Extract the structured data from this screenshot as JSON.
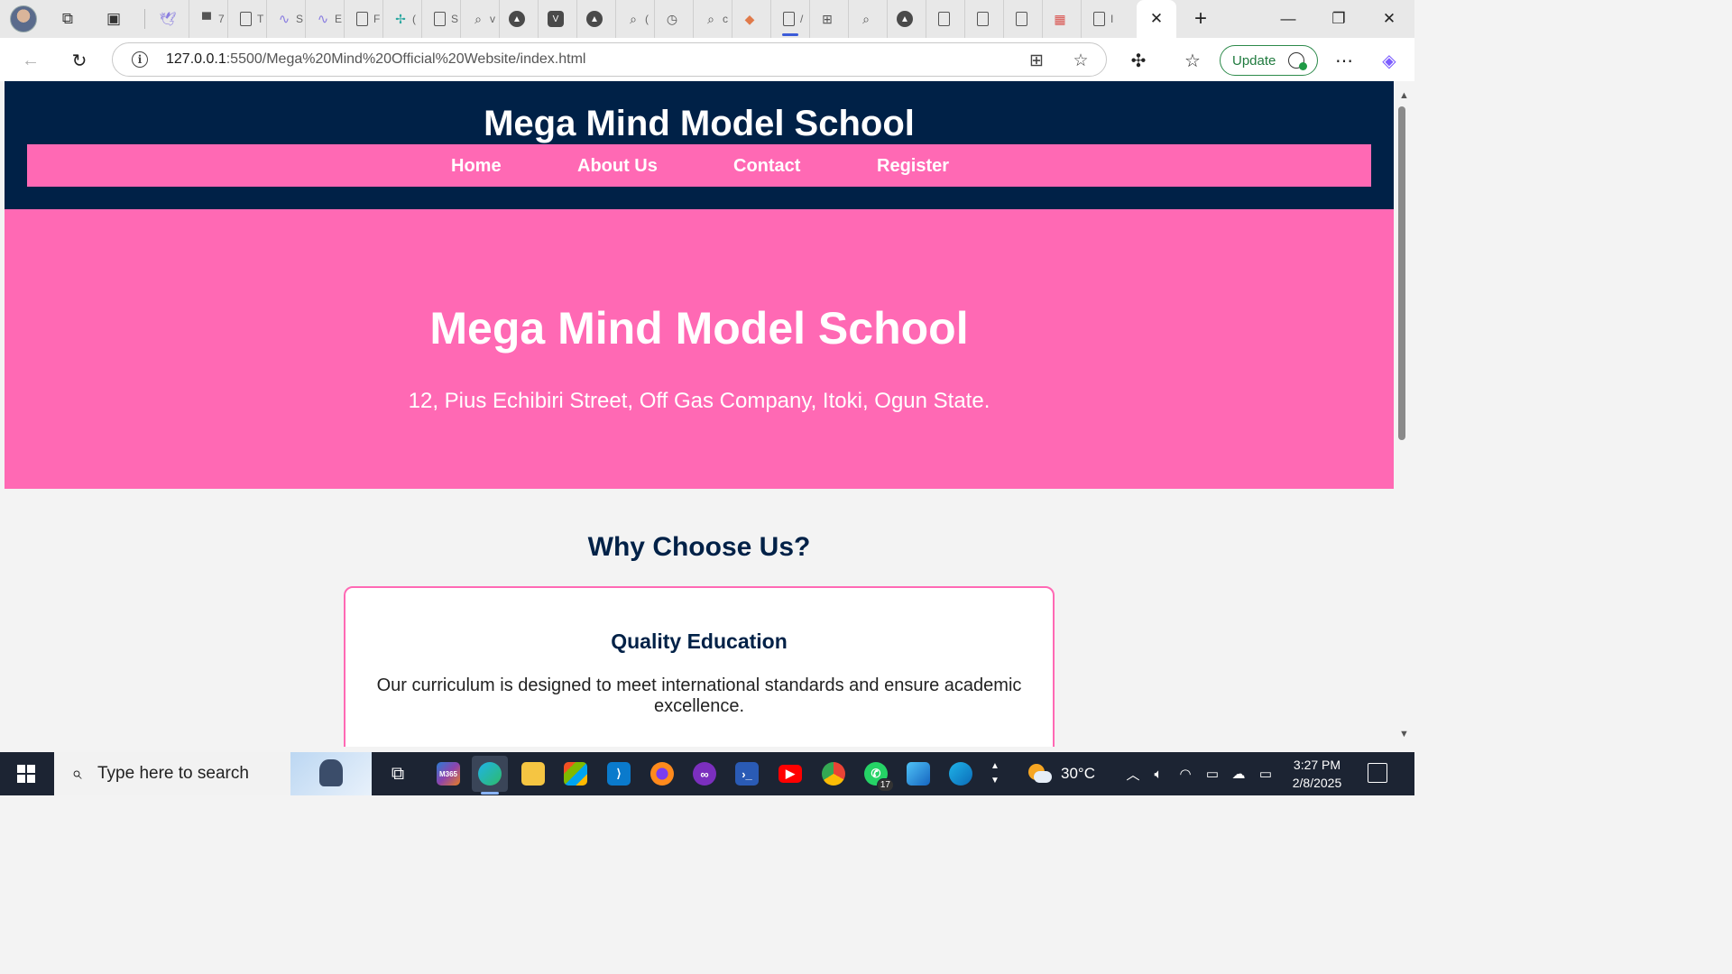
{
  "browser": {
    "active_tab_close": "✕",
    "new_tab": "+",
    "minimize": "—",
    "restore": "❐",
    "close": "✕",
    "url_host": "127.0.0.1",
    "url_rest": ":5500/Mega%20Mind%20Official%20Website/index.html",
    "update_label": "Update",
    "tab_fragments": [
      "7",
      "S",
      "E",
      "F",
      "(",
      "S",
      "v",
      "(",
      "c",
      "/",
      "I"
    ]
  },
  "site": {
    "header_title": "Mega Mind Model School",
    "nav": [
      "Home",
      "About Us",
      "Contact",
      "Register"
    ],
    "hero_title": "Mega Mind Model School",
    "hero_address": "12, Pius Echibiri Street, Off Gas Company, Itoki, Ogun State.",
    "section_title": "Why Choose Us?",
    "feature_title": "Quality Education",
    "feature_text": "Our curriculum is designed to meet international standards and ensure academic excellence.",
    "colors": {
      "navy": "#002147",
      "pink": "#ff69b4",
      "background": "#f3f3f3"
    }
  },
  "taskbar": {
    "search_placeholder": "Type here to search",
    "weather": "30°C",
    "time": "3:27 PM",
    "date": "2/8/2025",
    "whatsapp_badge": "17",
    "m365_label": "M365"
  }
}
